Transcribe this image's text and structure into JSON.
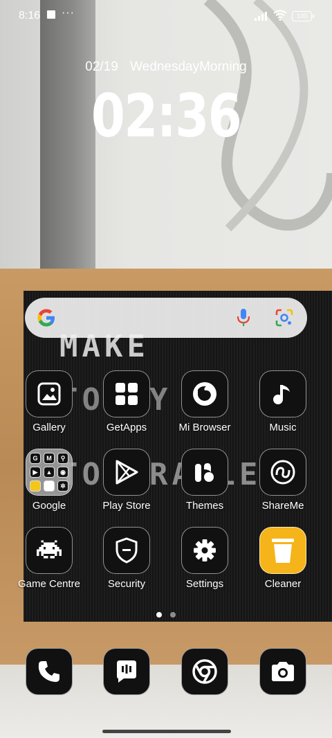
{
  "status_bar": {
    "time": "8:16",
    "more": "···",
    "battery": "100"
  },
  "clock_widget": {
    "date": "02/19",
    "day": "WednesdayMorning",
    "time": "02:36"
  },
  "wallpaper_board": {
    "line1": "MAKE",
    "line2": "TODAY",
    "line3": "TOLERABLE"
  },
  "apps": [
    {
      "label": "Gallery",
      "icon": "gallery-icon"
    },
    {
      "label": "GetApps",
      "icon": "getapps-icon"
    },
    {
      "label": "Mi Browser",
      "icon": "browser-icon"
    },
    {
      "label": "Music",
      "icon": "music-icon"
    },
    {
      "label": "Google",
      "icon": "google-folder-icon"
    },
    {
      "label": "Play Store",
      "icon": "play-store-icon"
    },
    {
      "label": "Themes",
      "icon": "themes-icon"
    },
    {
      "label": "ShareMe",
      "icon": "shareme-icon"
    },
    {
      "label": "Game Centre",
      "icon": "game-centre-icon"
    },
    {
      "label": "Security",
      "icon": "security-icon"
    },
    {
      "label": "Settings",
      "icon": "settings-icon"
    },
    {
      "label": "Cleaner",
      "icon": "cleaner-icon"
    }
  ],
  "dock": [
    {
      "icon": "phone-icon"
    },
    {
      "icon": "messages-icon"
    },
    {
      "icon": "chrome-icon"
    },
    {
      "icon": "camera-icon"
    }
  ],
  "pager": {
    "pages": 2,
    "current": 1
  },
  "colors": {
    "accent_cleaner": "#f5b419",
    "icon_bg": "#111111"
  }
}
